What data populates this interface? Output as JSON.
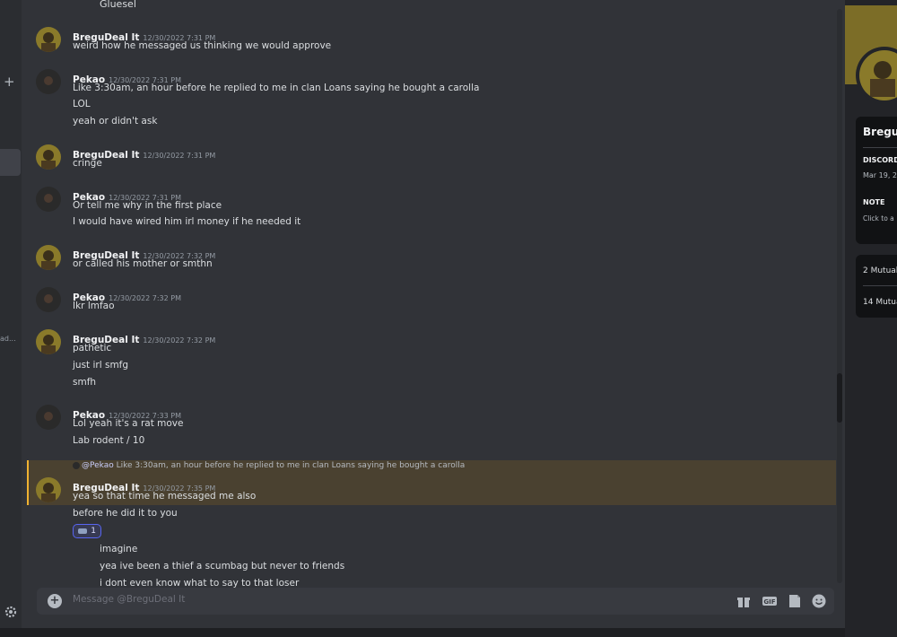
{
  "sidebar": {
    "plus": "+",
    "truncated_label": "ad..."
  },
  "chat": {
    "top_partial": "Gluesel",
    "groups": [
      {
        "author": "BreguDeal It",
        "timestamp": "12/30/2022 7:31 PM",
        "lines": [
          "weird how he messaged us thinking we would approve"
        ]
      },
      {
        "author": "Pekao",
        "timestamp": "12/30/2022 7:31 PM",
        "lines": [
          "Like 3:30am, an hour before he replied to me in clan Loans saying he bought a carolla",
          "LOL",
          "yeah or didn't ask"
        ]
      },
      {
        "author": "BreguDeal It",
        "timestamp": "12/30/2022 7:31 PM",
        "lines": [
          "cringe"
        ]
      },
      {
        "author": "Pekao",
        "timestamp": "12/30/2022 7:31 PM",
        "lines": [
          "Or tell me why in the first place",
          "I would have wired him irl money if he needed it"
        ]
      },
      {
        "author": "BreguDeal It",
        "timestamp": "12/30/2022 7:32 PM",
        "lines": [
          "or called his mother or smthn"
        ]
      },
      {
        "author": "Pekao",
        "timestamp": "12/30/2022 7:32 PM",
        "lines": [
          "Ikr lmfao"
        ]
      },
      {
        "author": "BreguDeal It",
        "timestamp": "12/30/2022 7:32 PM",
        "lines": [
          "pathetic",
          "just irl smfg",
          "smfh"
        ]
      },
      {
        "author": "Pekao",
        "timestamp": "12/30/2022 7:33 PM",
        "lines": [
          "Lol yeah it's a rat move",
          "Lab rodent / 10"
        ]
      },
      {
        "author": "BreguDeal It",
        "timestamp": "12/30/2022 7:35 PM",
        "lines": [
          "yea so that time he messaged me also",
          "before he did it to you"
        ]
      }
    ],
    "reply": {
      "mention": "@Pekao",
      "text": "Like 3:30am, an hour before he replied to me in clan Loans saying he bought a carolla"
    },
    "reaction": {
      "count": "1"
    },
    "trailing_lines": [
      "imagine",
      "yea ive been a thief a scumbag but never to friends",
      "i dont even know what to say to that loser"
    ]
  },
  "composer": {
    "placeholder": "Message @BreguDeal It"
  },
  "profile": {
    "name": "Bregu",
    "discord_label": "DISCORD",
    "member_since": "Mar 19, 2",
    "note_label": "NOTE",
    "note_placeholder": "Click to a",
    "mutual_1": "2 Mutual",
    "mutual_2": "14 Mutua"
  },
  "colors": {
    "accent": "#5865f2",
    "highlight_bar": "#f0b232",
    "background": "#313338"
  }
}
